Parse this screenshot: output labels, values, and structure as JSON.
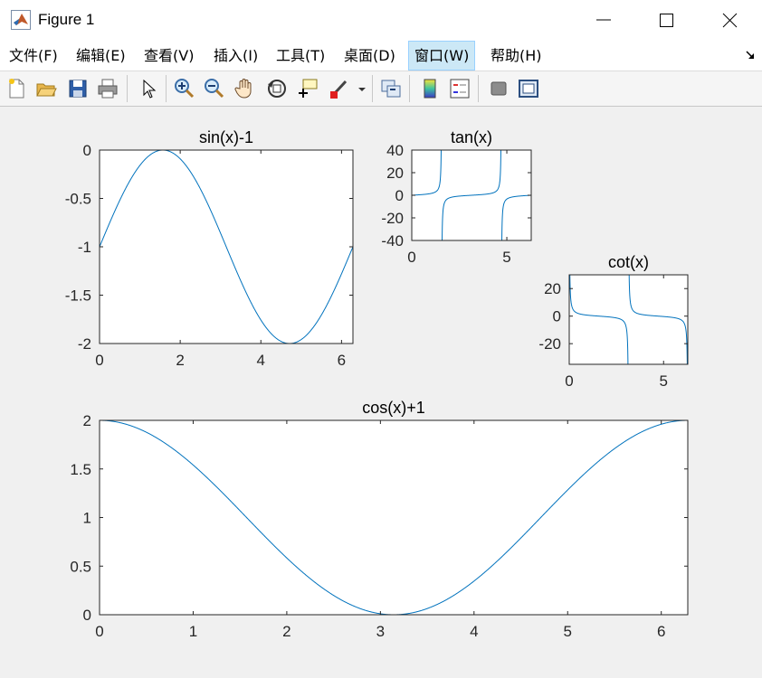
{
  "window": {
    "title": "Figure 1",
    "controls": {
      "minimize": "—",
      "maximize": "☐",
      "close": "✕"
    }
  },
  "menu": [
    {
      "label": "文件(F)"
    },
    {
      "label": "编辑(E)"
    },
    {
      "label": "查看(V)"
    },
    {
      "label": "插入(I)"
    },
    {
      "label": "工具(T)"
    },
    {
      "label": "桌面(D)"
    },
    {
      "label": "窗口(W)"
    },
    {
      "label": "帮助(H)"
    }
  ],
  "toolbar": {
    "buttons": [
      "new-figure-icon",
      "open-file-icon",
      "save-icon",
      "print-icon",
      "select-pointer-icon",
      "zoom-in-icon",
      "zoom-out-icon",
      "pan-hand-icon",
      "rotate-3d-icon",
      "data-cursor-icon",
      "brush-icon",
      "link-plot-icon",
      "colorbar-icon",
      "legend-icon",
      "hide-plot-tools-icon",
      "show-plot-tools-icon"
    ]
  },
  "colors": {
    "line": "#0072bd",
    "accent": "#cce8f6"
  },
  "chart_data": [
    {
      "type": "line",
      "title": "sin(x)-1",
      "function": "sin(x)-1",
      "xlim": [
        0,
        6.2832
      ],
      "ylim": [
        -2,
        0
      ],
      "xticks": [
        "0",
        "2",
        "4",
        "6"
      ],
      "yticks": [
        "0",
        "-0.5",
        "-1",
        "-1.5",
        "-2"
      ],
      "grid": false,
      "series": [
        {
          "x": [
            0,
            0.785,
            1.571,
            2.356,
            3.142,
            3.927,
            4.712,
            5.498,
            6.283
          ],
          "y": [
            -1,
            -0.293,
            0,
            -0.293,
            -1,
            -1.707,
            -2,
            -1.707,
            -1
          ]
        }
      ]
    },
    {
      "type": "line",
      "title": "tan(x)",
      "function": "tan(x)",
      "xlim": [
        0,
        6.2832
      ],
      "ylim": [
        -40,
        40
      ],
      "xticks": [
        "0",
        "5"
      ],
      "yticks": [
        "40",
        "20",
        "0",
        "-20",
        "-40"
      ],
      "grid": false,
      "series": [
        {
          "x": [
            0,
            1.0,
            1.55,
            1.59,
            2.5,
            3.14,
            4.0,
            4.69,
            4.73,
            6.28
          ],
          "y": [
            0,
            1.56,
            12,
            -37,
            -0.75,
            0,
            1.16,
            37,
            -12,
            0
          ]
        }
      ]
    },
    {
      "type": "line",
      "title": "cot(x)",
      "function": "cot(x)",
      "xlim": [
        0,
        6.2832
      ],
      "ylim": [
        -35,
        30
      ],
      "xticks": [
        "0",
        "5"
      ],
      "yticks": [
        "20",
        "0",
        "-20"
      ],
      "grid": false,
      "series": [
        {
          "x": [
            0.06,
            0.5,
            1.57,
            2.6,
            3.08,
            3.2,
            4.7,
            6.2,
            6.28
          ],
          "y": [
            10,
            1.8,
            0,
            -1.7,
            -18,
            18,
            0,
            -12,
            -35
          ]
        }
      ]
    },
    {
      "type": "line",
      "title": "cos(x)+1",
      "function": "cos(x)+1",
      "xlim": [
        0,
        6.2832
      ],
      "ylim": [
        0,
        2
      ],
      "xticks": [
        "0",
        "1",
        "2",
        "3",
        "4",
        "5",
        "6"
      ],
      "yticks": [
        "2",
        "1.5",
        "1",
        "0.5",
        "0"
      ],
      "grid": false,
      "series": [
        {
          "x": [
            0,
            0.785,
            1.571,
            2.356,
            3.142,
            3.927,
            4.712,
            5.498,
            6.283
          ],
          "y": [
            2,
            1.707,
            1,
            0.293,
            0,
            0.293,
            1,
            1.707,
            2
          ]
        }
      ]
    }
  ]
}
